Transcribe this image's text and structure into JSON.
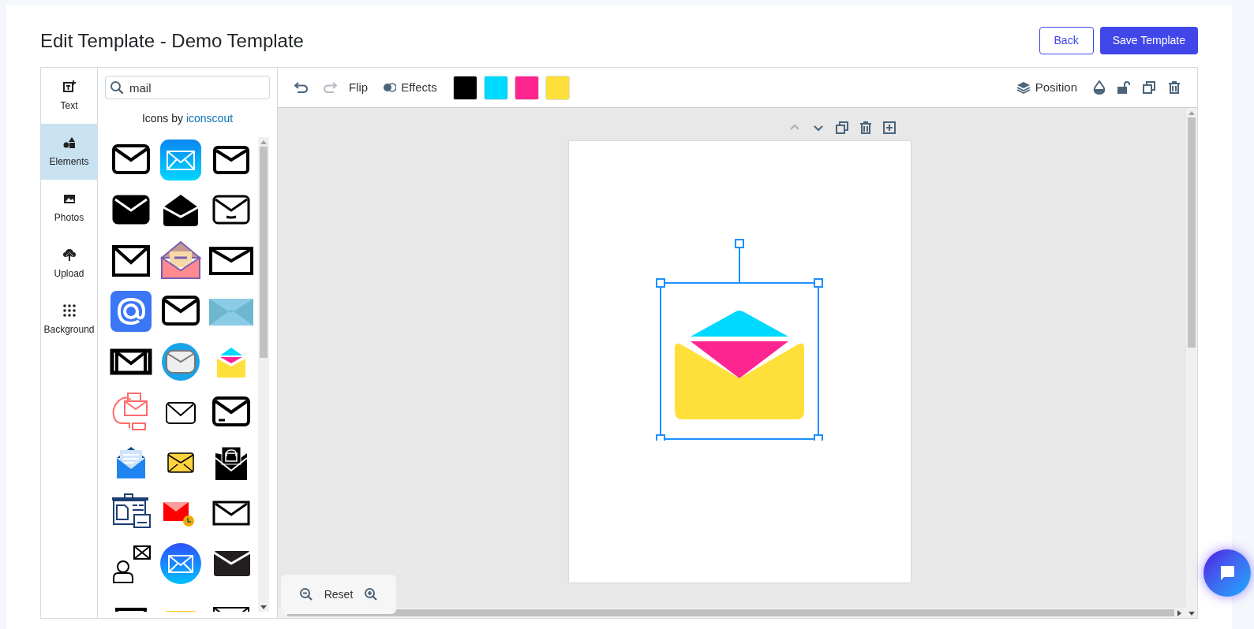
{
  "header": {
    "title": "Edit Template - Demo Template",
    "buttons": [
      {
        "label": "Back",
        "kind": "secondary"
      },
      {
        "label": "Save Template",
        "kind": "primary"
      }
    ]
  },
  "sidebar": {
    "items": [
      {
        "label": "Text",
        "kind": "text",
        "selected": false
      },
      {
        "label": "Elements",
        "kind": "elements",
        "selected": true
      },
      {
        "label": "Photos",
        "kind": "photos",
        "selected": false
      },
      {
        "label": "Upload",
        "kind": "upload",
        "selected": false
      },
      {
        "label": "Background",
        "kind": "background",
        "selected": false
      }
    ]
  },
  "panel": {
    "search": {
      "value": "mail"
    },
    "credit": {
      "text": "Icons by",
      "link": "iconscout"
    }
  },
  "toolbar": {
    "undo": {
      "disabled": false
    },
    "redo": {
      "disabled": true
    },
    "flip": "Flip",
    "effects": "Effects",
    "swatches": [
      {
        "color": "#000000"
      },
      {
        "color": "#00d9ff"
      },
      {
        "color": "#ff2590"
      },
      {
        "color": "#ffe03a"
      }
    ],
    "position": "Position"
  },
  "zoom": {
    "reset": "Reset"
  }
}
